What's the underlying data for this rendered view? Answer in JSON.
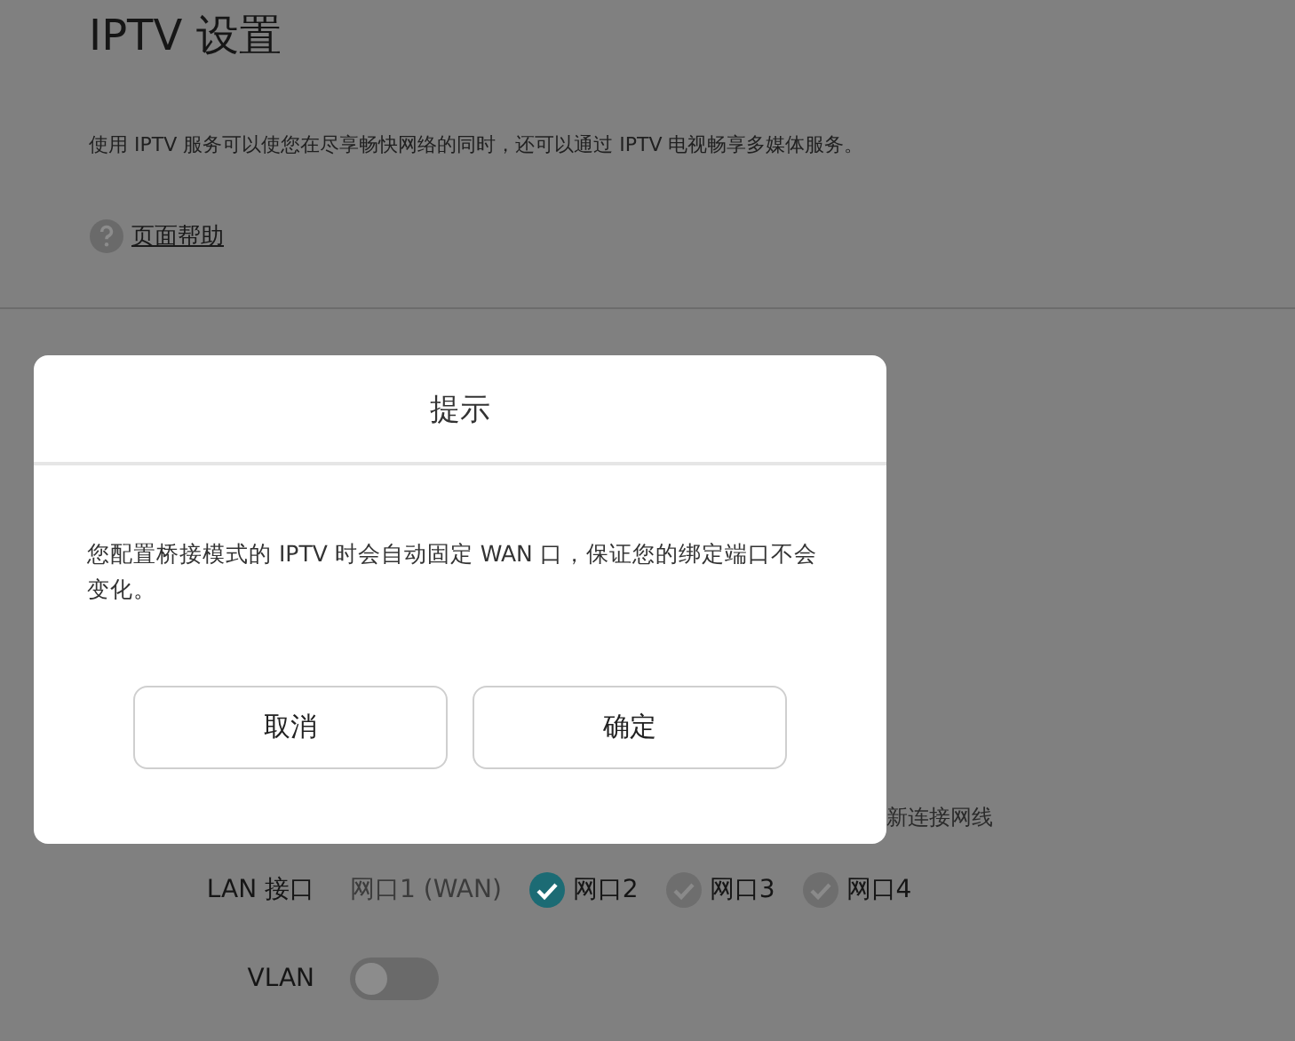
{
  "page": {
    "title": "IPTV 设置",
    "description": "使用 IPTV 服务可以使您在尽享畅快网络的同时，还可以通过 IPTV 电视畅享多媒体服务。",
    "help_link": "页面帮助"
  },
  "note_fragment": "新连接网线",
  "lan": {
    "label": "LAN 接口",
    "ports": [
      {
        "kind": "fixed",
        "label": "网口1 (WAN)"
      },
      {
        "kind": "checkbox",
        "label": "网口2",
        "checked": true
      },
      {
        "kind": "checkbox",
        "label": "网口3",
        "checked": false
      },
      {
        "kind": "checkbox",
        "label": "网口4",
        "checked": false
      }
    ]
  },
  "vlan": {
    "label": "VLAN",
    "on": false
  },
  "dialog": {
    "title": "提示",
    "message": "您配置桥接模式的 IPTV 时会自动固定 WAN 口，保证您的绑定端口不会变化。",
    "buttons": [
      "取消",
      "确定"
    ]
  }
}
